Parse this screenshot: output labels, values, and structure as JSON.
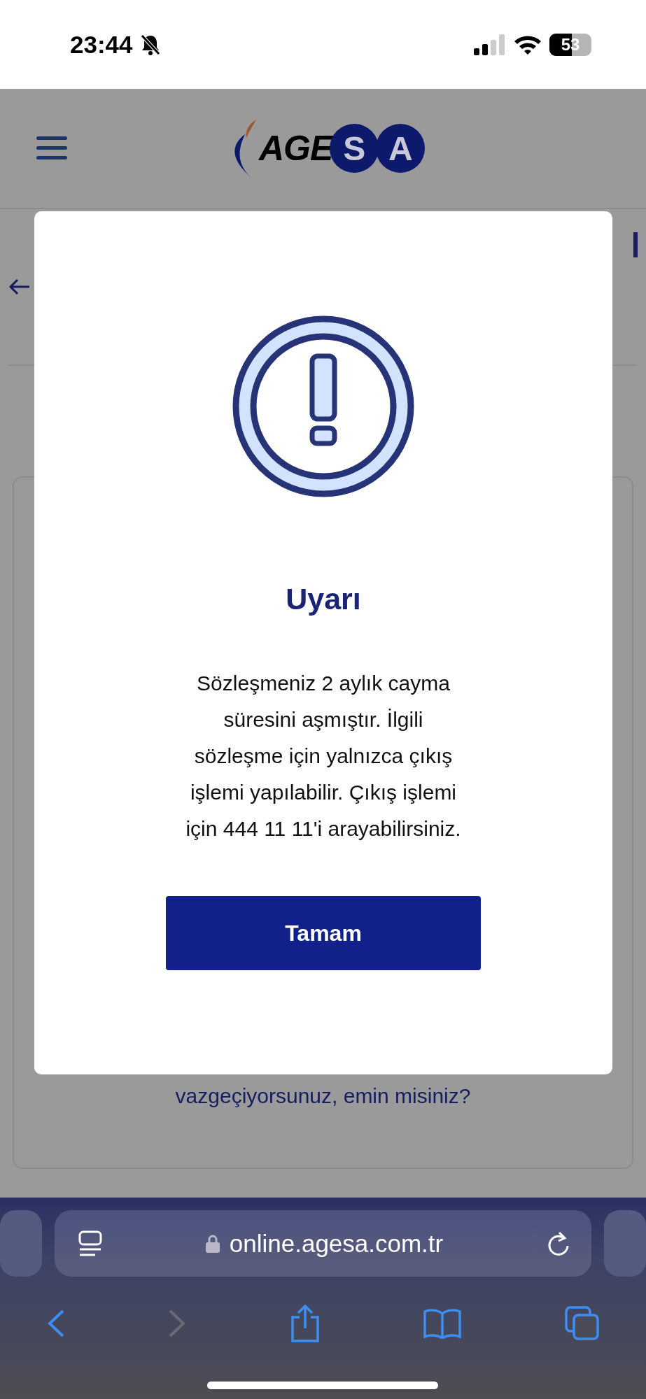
{
  "status_bar": {
    "time": "23:44",
    "silent": true,
    "battery": "53"
  },
  "header": {
    "logo": {
      "plain": "AGE",
      "circled": [
        "S",
        "A"
      ]
    }
  },
  "page": {
    "footer_text": "vazgeçiyorsunuz, emin misiniz?"
  },
  "dialog": {
    "title": "Uyarı",
    "message_lines": [
      "Sözleşmeniz 2 aylık cayma",
      "süresini aşmıştır. İlgili",
      "sözleşme için yalnızca çıkış",
      "işlemi yapılabilir. Çıkış işlemi",
      "için 444 11 11'i arayabilirsiniz."
    ],
    "button": "Tamam"
  },
  "browser": {
    "url": "online.agesa.com.tr",
    "forward_disabled": true
  }
}
